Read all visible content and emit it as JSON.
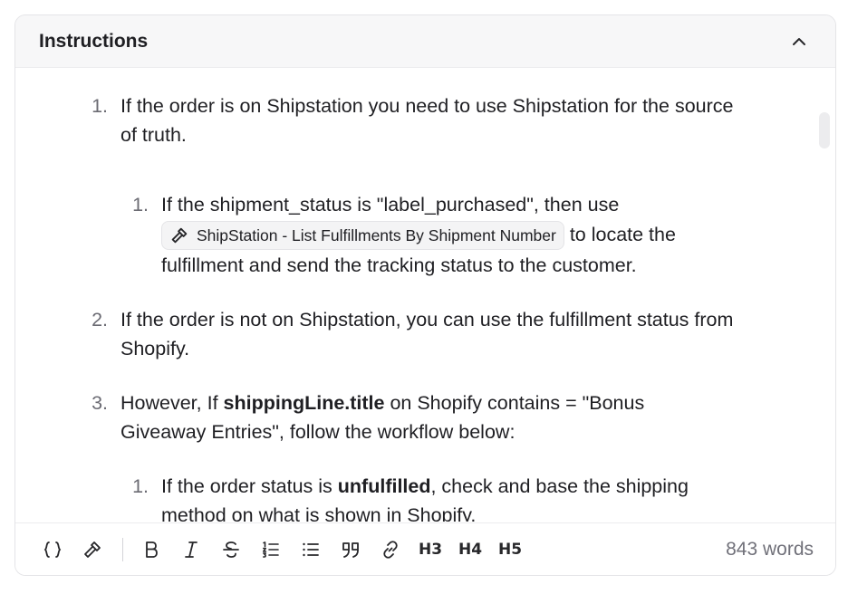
{
  "panel": {
    "title": "Instructions"
  },
  "content": {
    "items": [
      {
        "number": "1.",
        "text": "If the order is on Shipstation you need to use Shipstation for the source of truth."
      },
      {
        "number": "1.",
        "text_before": "If the shipment_status is \"label_purchased\", then use",
        "chip_label": "ShipStation - List Fulfillments By Shipment Number",
        "text_after": "to locate the",
        "text_line3": "fulfillment and send the tracking status to the customer."
      },
      {
        "number": "2.",
        "text": "If the order is not on Shipstation, you can use the fulfillment status from Shopify."
      },
      {
        "number": "3.",
        "text_before": "However, If ",
        "bold": "shippingLine.title",
        "text_after": " on Shopify contains = \"Bonus",
        "text_line2": "Giveaway Entries\", follow the workflow below:"
      },
      {
        "number": "1.",
        "text_before": "If the order status is ",
        "bold": "unfulfilled",
        "text_after": ", check and base the shipping",
        "text_line2": "method on what is shown in Shopify."
      }
    ]
  },
  "toolbar": {
    "buttons": [
      "code",
      "tool",
      "bold",
      "italic",
      "strikethrough",
      "ordered-list",
      "bullet-list",
      "quote",
      "link",
      "h3",
      "h4",
      "h5"
    ],
    "h3": "H3",
    "h4": "H4",
    "h5": "H5",
    "word_count": "843 words"
  }
}
